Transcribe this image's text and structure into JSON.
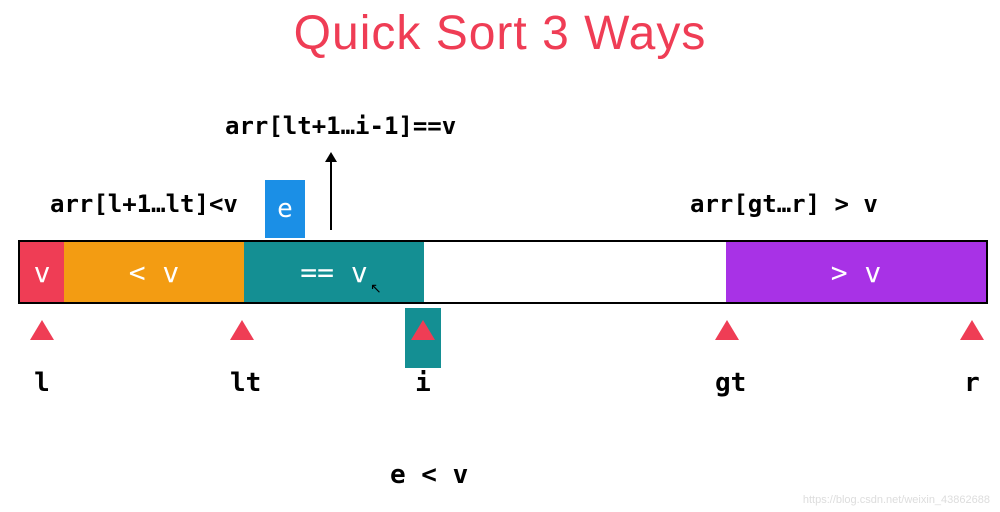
{
  "title": "Quick Sort 3 Ways",
  "colors": {
    "title": "#ef3d55",
    "v": "#ef3d55",
    "lt": "#f39c12",
    "eq": "#148f93",
    "gt": "#a832e6",
    "e_box": "#1b8fe6",
    "i_box": "#148f93",
    "tri": "#ef3d55"
  },
  "segments": {
    "v": "v",
    "lt": "< v",
    "eq": "== v",
    "gt": "> v"
  },
  "annotations": {
    "lt_range": "arr[l+1…lt]<v",
    "eq_range": "arr[lt+1…i-1]==v",
    "gt_range": "arr[gt…r] > v",
    "e_label": "e",
    "bottom_condition": "e < v"
  },
  "pointers": {
    "l": "l",
    "lt": "lt",
    "i": "i",
    "gt": "gt",
    "r": "r"
  },
  "watermark": "https://blog.csdn.net/weixin_43862688"
}
